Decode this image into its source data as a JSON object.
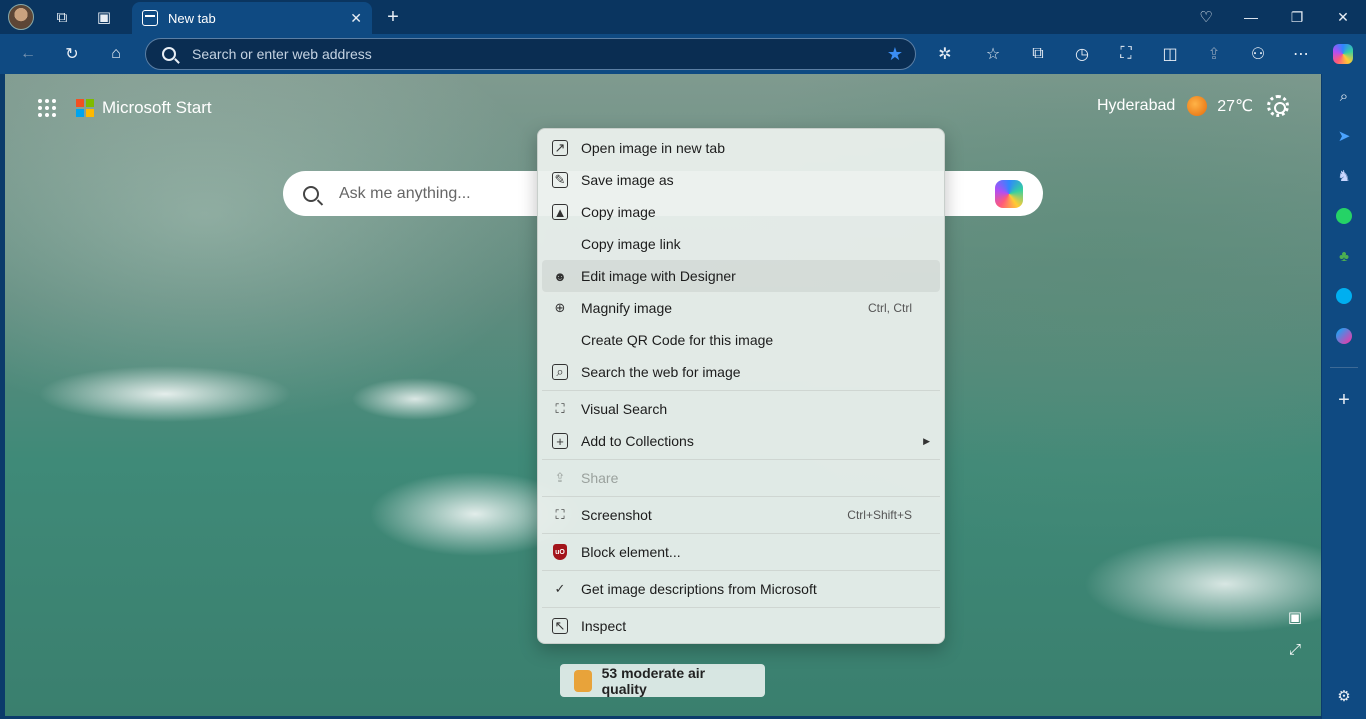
{
  "tabbar": {
    "tab_title": "New tab",
    "tab_close": "✕",
    "new_tab": "+",
    "minimize": "—",
    "restore": "❐",
    "close": "✕"
  },
  "toolbar": {
    "address_placeholder": "Search or enter web address"
  },
  "page": {
    "brand": "Microsoft Start",
    "city": "Hyderabad",
    "temperature": "27℃",
    "search_placeholder": "Ask me anything...",
    "air_quality": "53 moderate air quality"
  },
  "menu": {
    "open_image_new_tab": "Open image in new tab",
    "save_image_as": "Save image as",
    "copy_image": "Copy image",
    "copy_image_link": "Copy image link",
    "edit_with_designer": "Edit image with Designer",
    "magnify_image": "Magnify image",
    "magnify_shortcut": "Ctrl, Ctrl",
    "create_qr": "Create QR Code for this image",
    "search_web": "Search the web for image",
    "visual_search": "Visual Search",
    "add_collections": "Add to Collections",
    "share": "Share",
    "screenshot": "Screenshot",
    "screenshot_shortcut": "Ctrl+Shift+S",
    "block_element": "Block element...",
    "image_descriptions": "Get image descriptions from Microsoft",
    "inspect": "Inspect"
  },
  "colors": {
    "tabbar_bg": "#0a3560",
    "toolbar_bg": "#0f4a82",
    "accent_star": "#3b8df5",
    "ublock_red": "#a3141b"
  }
}
